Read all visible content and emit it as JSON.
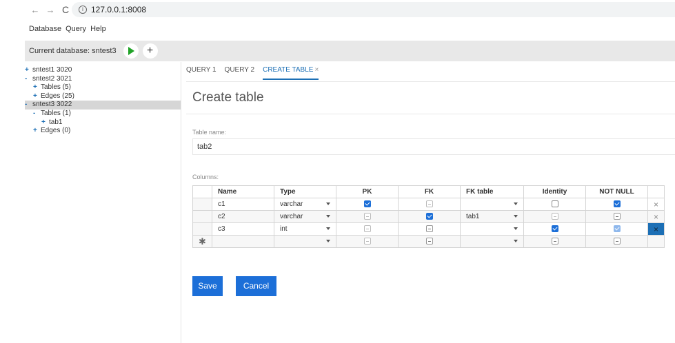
{
  "browser": {
    "back": "←",
    "forward": "→",
    "reload": "C",
    "info": "i",
    "url": "127.0.0.1:8008"
  },
  "menu": [
    "Database",
    "Query",
    "Help"
  ],
  "toolbar": {
    "current_db_label": "Current database: sntest3",
    "add_label": "+"
  },
  "sidebar": {
    "items": [
      {
        "sign": "+",
        "label": "sntest1 3020",
        "indent": 0
      },
      {
        "sign": "-",
        "label": "sntest2 3021",
        "indent": 0
      },
      {
        "sign": "+",
        "label": "Tables (5)",
        "indent": 1
      },
      {
        "sign": "+",
        "label": "Edges (25)",
        "indent": 1
      },
      {
        "sign": "-",
        "label": "sntest3 3022",
        "indent": 0,
        "selected": true
      },
      {
        "sign": "-",
        "label": "Tables (1)",
        "indent": 1
      },
      {
        "sign": "+",
        "label": "tab1",
        "indent": 2
      },
      {
        "sign": "+",
        "label": "Edges (0)",
        "indent": 1
      }
    ]
  },
  "tabs": [
    {
      "label": "QUERY 1"
    },
    {
      "label": "QUERY 2"
    },
    {
      "label": "CREATE TABLE",
      "active": true,
      "close": "×"
    }
  ],
  "main": {
    "title": "Create table",
    "table_name_label": "Table name:",
    "table_name_value": "tab2",
    "columns_label": "Columns:",
    "save_label": "Save",
    "cancel_label": "Cancel"
  },
  "grid": {
    "headers": [
      "Name",
      "Type",
      "PK",
      "FK",
      "FK table",
      "Identity",
      "NOT NULL"
    ],
    "new_row_marker": "✱",
    "delete_glyph": "×",
    "rows": [
      {
        "name": "c1",
        "type": "varchar",
        "pk": "checked",
        "fk": "indet-faded",
        "fk_table": "",
        "identity": "empty",
        "not_null": "checked"
      },
      {
        "name": "c2",
        "type": "varchar",
        "pk": "indet-faded",
        "fk": "checked",
        "fk_table": "tab1",
        "identity": "indet-faded",
        "not_null": "indet"
      },
      {
        "name": "c3",
        "type": "int",
        "pk": "indet-faded",
        "fk": "indet",
        "fk_table": "",
        "identity": "checked",
        "not_null": "checked-light"
      },
      {
        "name": "",
        "type": "",
        "pk": "indet-faded",
        "fk": "indet",
        "fk_table": "",
        "identity": "indet",
        "not_null": "indet"
      }
    ]
  },
  "colors": {
    "accent": "#1c6fb5",
    "button": "#1c6fd8",
    "run": "#21a328",
    "toolbar_bg": "#e8e8e8",
    "selected_row": "#d6d6d6"
  }
}
